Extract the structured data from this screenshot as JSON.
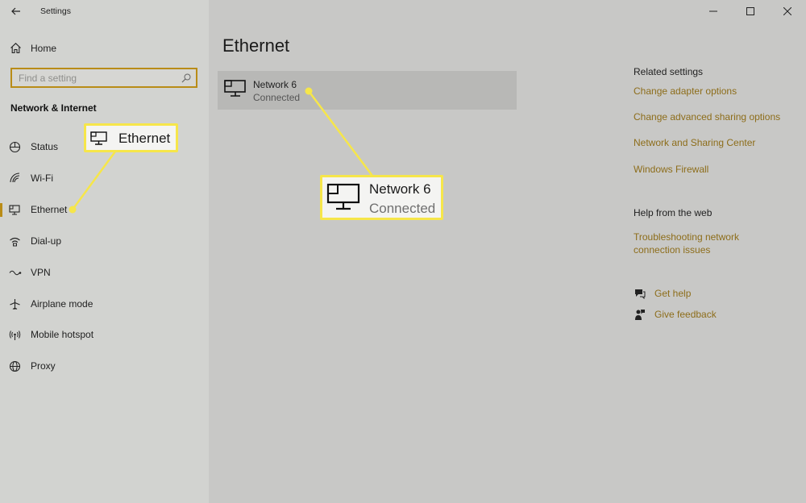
{
  "window": {
    "title": "Settings"
  },
  "sidebar": {
    "home_label": "Home",
    "search_placeholder": "Find a setting",
    "section_title": "Network & Internet",
    "items": [
      {
        "label": "Status",
        "icon": "status-icon"
      },
      {
        "label": "Wi-Fi",
        "icon": "wifi-icon"
      },
      {
        "label": "Ethernet",
        "icon": "ethernet-icon",
        "active": true
      },
      {
        "label": "Dial-up",
        "icon": "dialup-icon"
      },
      {
        "label": "VPN",
        "icon": "vpn-icon"
      },
      {
        "label": "Airplane mode",
        "icon": "airplane-icon"
      },
      {
        "label": "Mobile hotspot",
        "icon": "hotspot-icon"
      },
      {
        "label": "Proxy",
        "icon": "globe-icon"
      }
    ]
  },
  "main": {
    "title": "Ethernet",
    "network": {
      "name": "Network 6",
      "status": "Connected"
    },
    "related": {
      "heading": "Related settings",
      "links": [
        "Change adapter options",
        "Change advanced sharing options",
        "Network and Sharing Center",
        "Windows Firewall"
      ],
      "help_heading": "Help from the web",
      "help_link": "Troubleshooting network connection issues",
      "get_help": "Get help",
      "give_feedback": "Give feedback"
    }
  },
  "callouts": {
    "ethernet_label": "Ethernet",
    "network_name": "Network 6",
    "network_status": "Connected"
  },
  "colors": {
    "accent": "#b98c17",
    "link": "#8d6d1a",
    "callout_border": "#f6e64a"
  }
}
